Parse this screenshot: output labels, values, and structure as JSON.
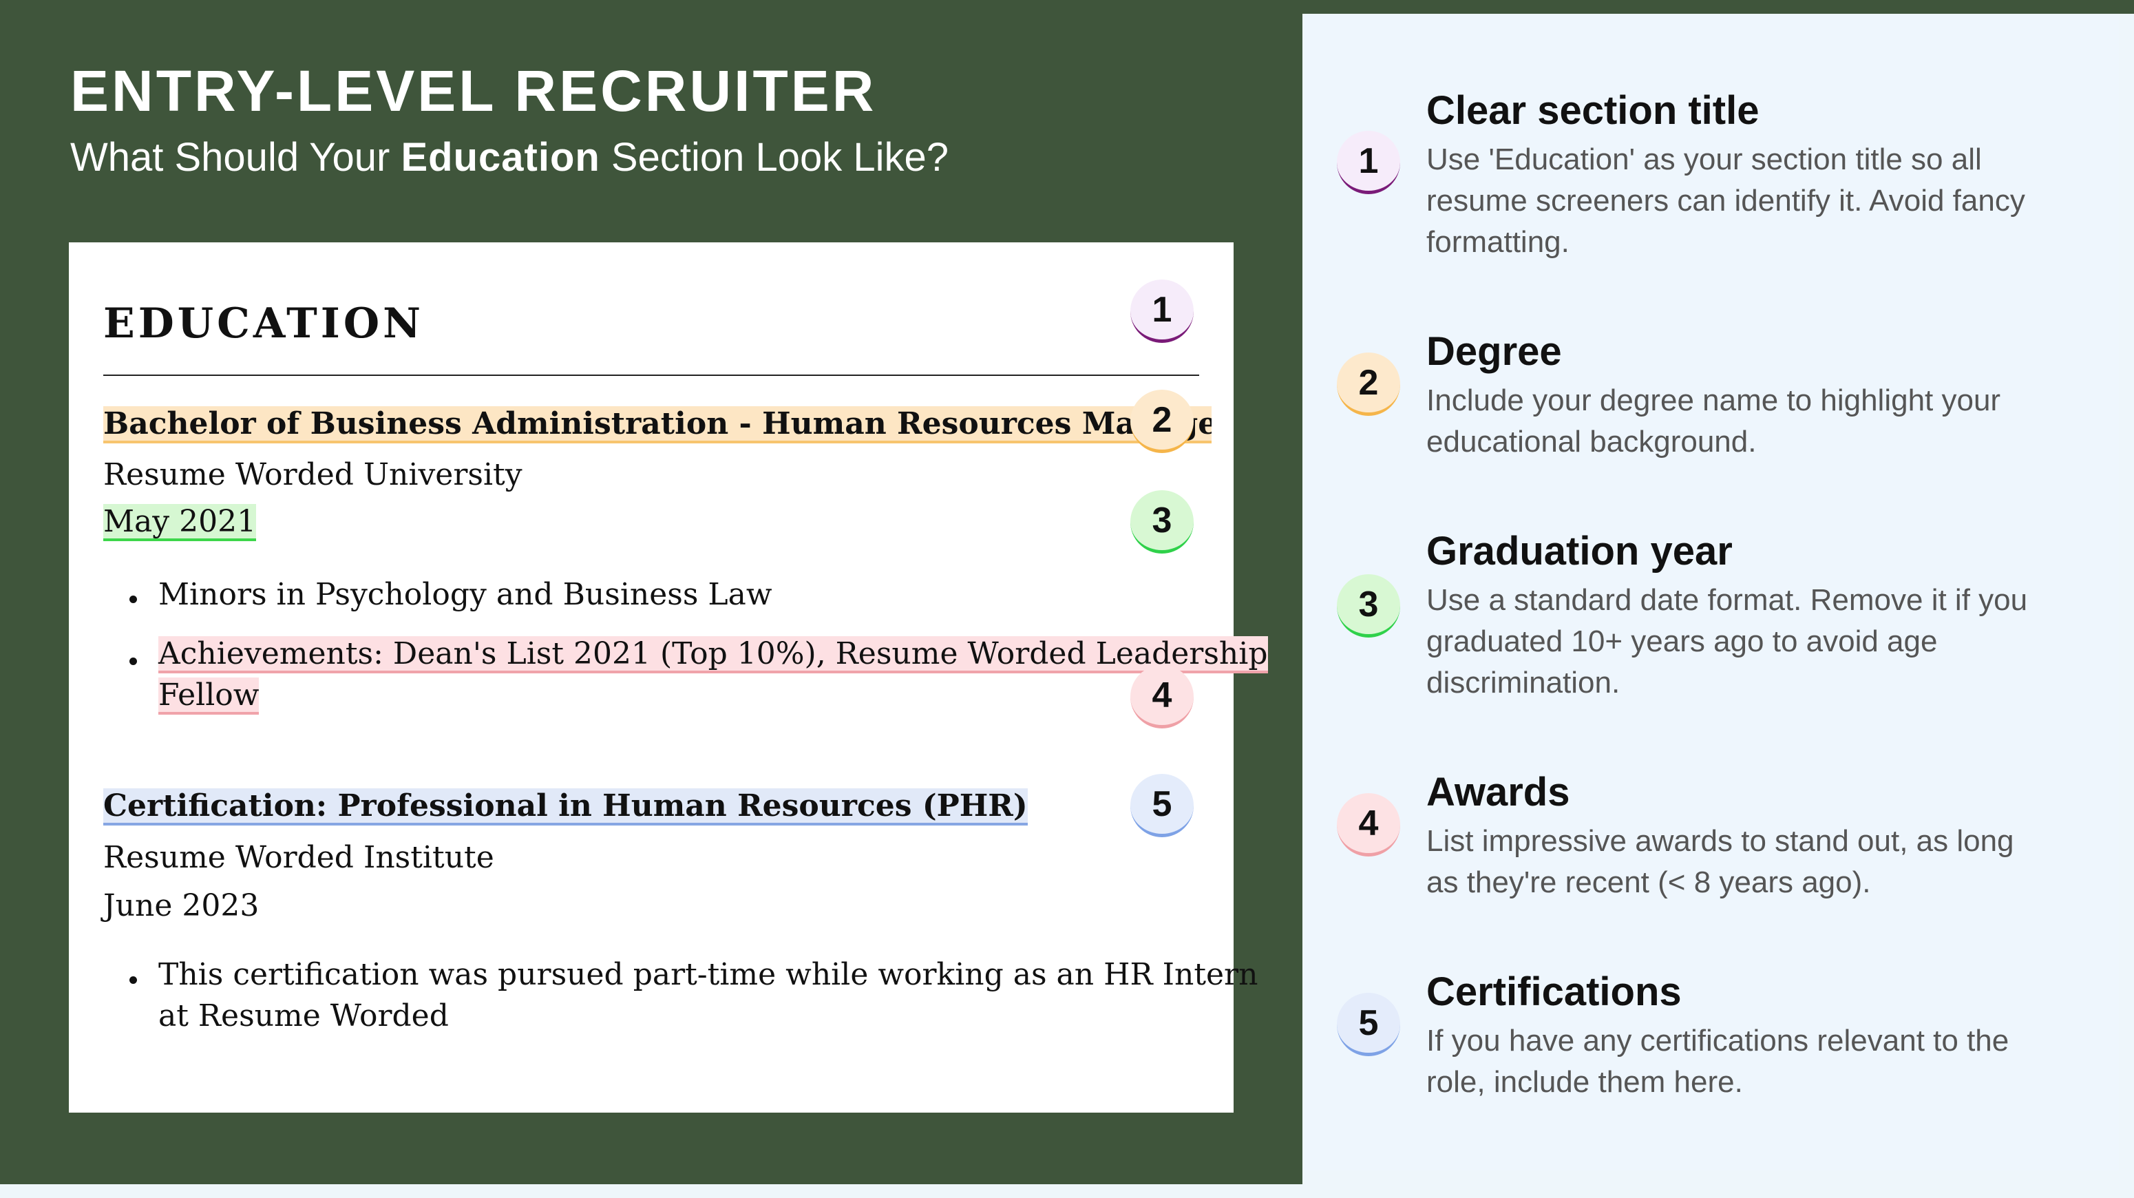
{
  "header": {
    "title": "ENTRY-LEVEL RECRUITER",
    "subtitle_pre": "What Should Your ",
    "subtitle_bold": "Education",
    "subtitle_post": " Section Look Like?"
  },
  "resume": {
    "section_heading": "EDUCATION",
    "degree": "Bachelor of Business Administration - Human Resources Management",
    "university": "Resume Worded University",
    "grad_date": "May 2021",
    "bullets_1": [
      "Minors in Psychology and Business Law",
      "Achievements: Dean's List 2021 (Top 10%), Resume Worded Leadership",
      "Fellow"
    ],
    "certification": "Certification: Professional in Human Resources (PHR)",
    "institute": "Resume Worded Institute",
    "cert_date": "June 2023",
    "bullets_2": [
      "This certification was pursued part-time while working as an HR Intern",
      "at Resume Worded"
    ]
  },
  "badges": [
    "1",
    "2",
    "3",
    "4",
    "5"
  ],
  "tips": [
    {
      "number": "1",
      "title": "Clear section title",
      "lines": [
        "Use 'Education' as your section title so all",
        "resume screeners can identify it. Avoid fancy",
        "formatting."
      ]
    },
    {
      "number": "2",
      "title": "Degree",
      "lines": [
        "Include your degree name to highlight your",
        "educational background."
      ]
    },
    {
      "number": "3",
      "title": "Graduation year",
      "lines": [
        "Use a standard date format. Remove it if you",
        "graduated 10+ years ago to avoid age",
        "discrimination."
      ]
    },
    {
      "number": "4",
      "title": "Awards",
      "lines": [
        "List impressive awards to stand out, as long",
        "as they're recent (< 8 years ago)."
      ]
    },
    {
      "number": "5",
      "title": "Certifications",
      "lines": [
        "If you have any certifications relevant to the",
        "role, include them here."
      ]
    }
  ],
  "colors": {
    "background_green": "#3f553b",
    "panel_light": "#eef6fd",
    "badge_1": "#7a1b78",
    "badge_2": "#f5b54a",
    "badge_3": "#2fd14a",
    "badge_4": "#efa0a6",
    "badge_5": "#7ea2e6"
  }
}
